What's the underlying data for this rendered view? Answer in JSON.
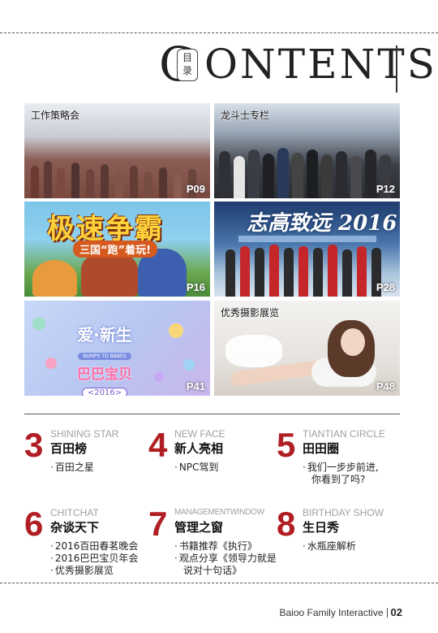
{
  "header": {
    "title_first_letter": "C",
    "title_rest": "ONTENTS",
    "seal_text": [
      "目",
      "录"
    ]
  },
  "photos": [
    {
      "caption": "工作策略会",
      "page": "P09"
    },
    {
      "caption": "龙斗士专栏",
      "page": "P12"
    },
    {
      "caption": "",
      "page": "P16",
      "art_title": "极速争霸",
      "art_subtitle": "三国“跑”着玩!"
    },
    {
      "caption": "",
      "page": "P28",
      "art_title": "志高致远 2016"
    },
    {
      "caption": "",
      "page": "P41",
      "art_title": "爱·新生",
      "art_en": "BUMPS TO BABES",
      "art_cn": "巴巴宝贝",
      "art_year": "<2016>"
    },
    {
      "caption": "优秀摄影展览",
      "page": "P48"
    }
  ],
  "sections": [
    {
      "num": "3",
      "en": "SHINING STAR",
      "cn": "百田榜",
      "items": [
        "百田之星"
      ]
    },
    {
      "num": "4",
      "en": "NEW FACE",
      "cn": "新人亮相",
      "items": [
        "NPC驾到"
      ]
    },
    {
      "num": "5",
      "en": "TIANTIAN CIRCLE",
      "cn": "田田圈",
      "items": [
        "我们一步步前进,",
        "你看到了吗?"
      ]
    },
    {
      "num": "6",
      "en": "CHITCHAT",
      "cn": "杂谈天下",
      "items": [
        "2016百田春茗晚会",
        "2016巴巴宝贝年会",
        "优秀摄影展览"
      ]
    },
    {
      "num": "7",
      "en": "MANAGEMENTWINDOW",
      "cn": "管理之窗",
      "items": [
        "书籍推荐《执行》",
        "观点分享《领导力就是",
        "说对十句话》"
      ]
    },
    {
      "num": "8",
      "en": "BIRTHDAY SHOW",
      "cn": "生日秀",
      "items": [
        "水瓶座解析"
      ]
    }
  ],
  "footer": {
    "company": "Baioo Family Interactive",
    "page": "02"
  }
}
